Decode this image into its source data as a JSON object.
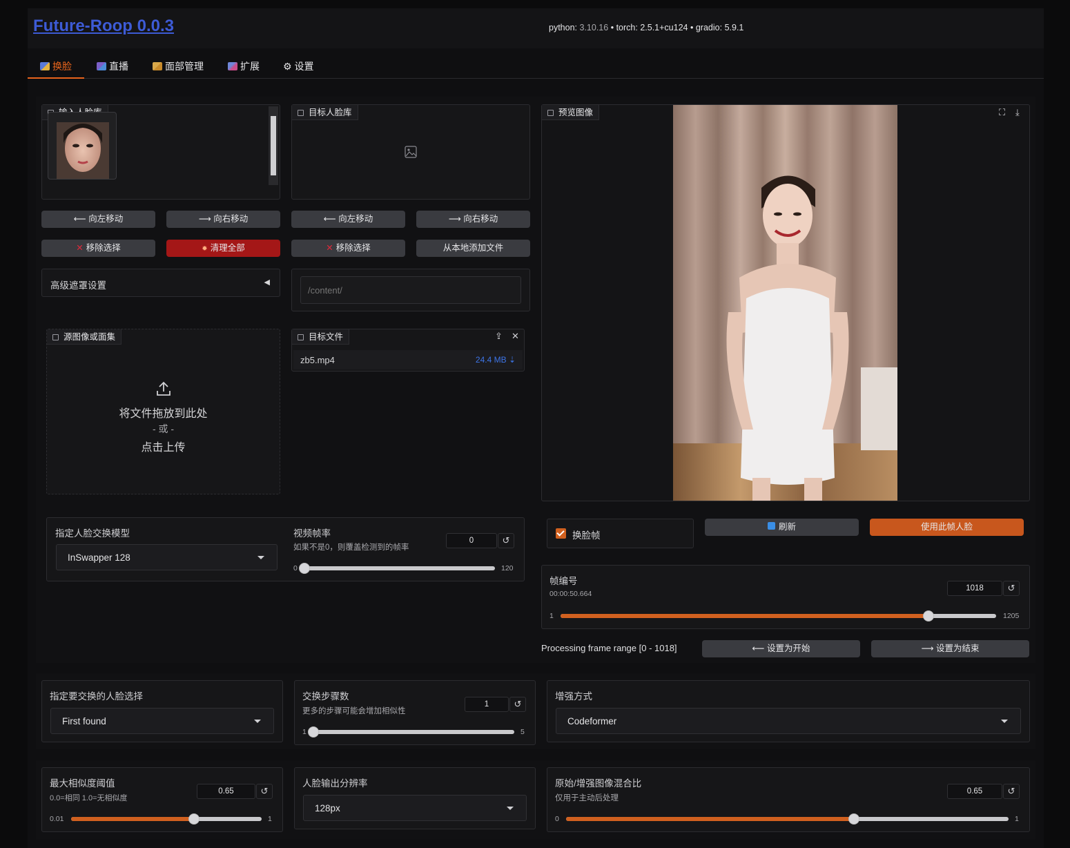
{
  "app": {
    "title": "Future-Roop 0.0.3",
    "versions": {
      "python_label": "python:",
      "python": "3.10.16",
      "torch_label": "torch:",
      "torch": "2.5.1+cu124",
      "gradio_label": "gradio:",
      "gradio": "5.9.1",
      "sep": "•"
    }
  },
  "tabs": [
    {
      "label": "换脸",
      "active": true
    },
    {
      "label": "直播"
    },
    {
      "label": "面部管理"
    },
    {
      "label": "扩展"
    },
    {
      "label": "⚙ 设置"
    }
  ],
  "input_faces": {
    "label": "输入人脸库",
    "move_left": "⟵ 向左移动",
    "move_right": "⟶ 向右移动",
    "remove": "移除选择",
    "remove_x": "✕",
    "clear_all": "清理全部",
    "clear_icon": "✹"
  },
  "target_faces": {
    "label": "目标人脸库",
    "move_left": "⟵ 向左移动",
    "move_right": "⟶ 向右移动",
    "remove": "移除选择",
    "remove_x": "✕",
    "add_local": "从本地添加文件",
    "path_placeholder": "/content/"
  },
  "mask_settings": {
    "label": "高级遮罩设置",
    "arrow": "◀"
  },
  "source_upload": {
    "label": "源图像或面集",
    "drop_text": "将文件拖放到此处",
    "or_text": "- 或 -",
    "click_text": "点击上传"
  },
  "target_file": {
    "label": "目标文件",
    "filename": "zb5.mp4",
    "size": "24.4 MB ⇣"
  },
  "preview": {
    "label": "预览图像"
  },
  "swap_model": {
    "label": "指定人脸交换模型",
    "value": "InSwapper 128"
  },
  "video_fps": {
    "label": "视频帧率",
    "info": "如果不是0，则覆盖检测到的帧率",
    "value": "0",
    "min": "0",
    "max": "120",
    "fraction": 0
  },
  "face_swap_frame": {
    "label": "换脸帧",
    "checked": true
  },
  "refresh": {
    "label": "刷新"
  },
  "use_face": {
    "label": "使用此帧人脸"
  },
  "frame_number": {
    "label": "帧编号",
    "timestamp": "00:00:50.664",
    "value": "1018",
    "min": "1",
    "max": "1205",
    "fraction": 0.844
  },
  "processing_range": {
    "text": "Processing frame range [0 - 1018]",
    "set_start": "⟵ 设置为开始",
    "set_end": "⟶ 设置为结束"
  },
  "face_selection": {
    "label": "指定要交换的人脸选择",
    "value": "First found"
  },
  "swap_steps": {
    "label": "交换步骤数",
    "info": "更多的步骤可能会增加相似性",
    "value": "1",
    "min": "1",
    "max": "5",
    "fraction": 0
  },
  "enhancer": {
    "label": "增强方式",
    "value": "Codeformer"
  },
  "max_similarity": {
    "label": "最大相似度阈值",
    "info": "0.0=相同 1.0=无相似度",
    "value": "0.65",
    "min": "0.01",
    "max": "1",
    "fraction": 0.646
  },
  "output_resolution": {
    "label": "人脸输出分辨率",
    "value": "128px"
  },
  "blend_ratio": {
    "label": "原始/增强图像混合比",
    "info": "仅用于主动后处理",
    "value": "0.65",
    "min": "0",
    "max": "1",
    "fraction": 0.65
  },
  "icons": {
    "reset": "↺",
    "upload": "⇪",
    "close": "✕",
    "fullscreen": "⛶",
    "download": "⤓"
  },
  "colors": {
    "accent": "#d0601f",
    "title": "#3d5bd6",
    "danger": "#a41717"
  }
}
